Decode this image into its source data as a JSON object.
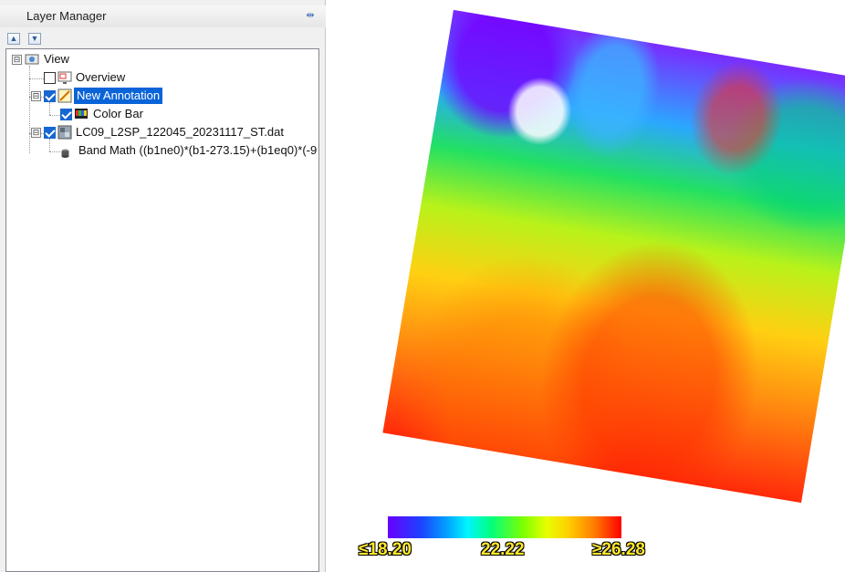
{
  "panel": {
    "title": "Layer Manager",
    "toolbar": {
      "up_icon": "chevron-up-icon",
      "down_icon": "chevron-down-icon",
      "pin_icon": "pin-icon"
    },
    "tree": {
      "view": {
        "label": "View",
        "expander": "⊟"
      },
      "overview": {
        "label": "Overview",
        "checked": false
      },
      "annotation": {
        "label": "New Annotation",
        "checked": true,
        "selected": true,
        "expander": "⊟"
      },
      "colorbar": {
        "label": "Color Bar",
        "checked": true
      },
      "dataset": {
        "label": "LC09_L2SP_122045_20231117_ST.dat",
        "checked": true,
        "expander": "⊟"
      },
      "bandmath": {
        "label": "Band Math ((b1ne0)*(b1-273.15)+(b1eq0)*(-9"
      }
    }
  },
  "map": {
    "colorbar": {
      "min_label": "≤18.20",
      "mid_label": "22.22",
      "max_label": "≥26.28",
      "colors": [
        "#6a00ff",
        "#00a8ff",
        "#00ff80",
        "#e7ff00",
        "#ff8000",
        "#ff0000"
      ]
    }
  }
}
